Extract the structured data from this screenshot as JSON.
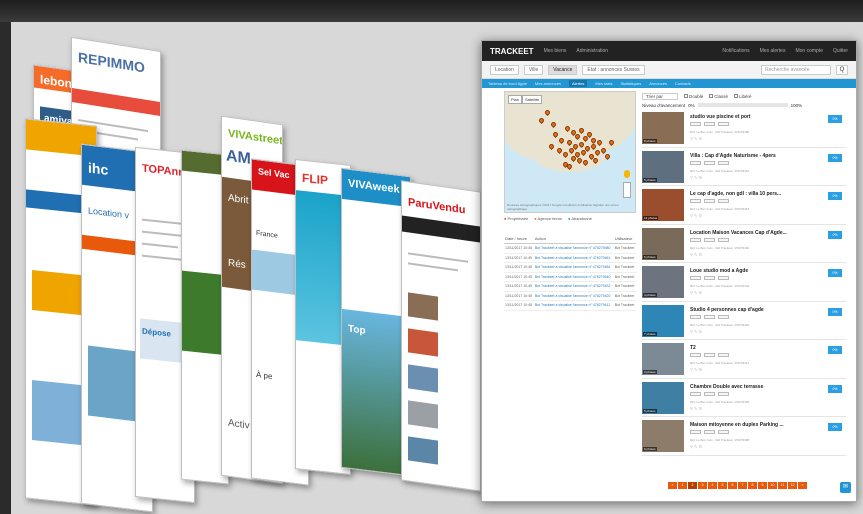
{
  "collage": {
    "sites": [
      {
        "brand": "",
        "color": "#f0a400"
      },
      {
        "brand": "leboncoin",
        "color": "#f56b2a"
      },
      {
        "brand": "REPIMMO",
        "color": "#4a6fa5"
      },
      {
        "brand": "ihc",
        "color": "#1f6fb2"
      },
      {
        "brand": "TOPAnnonces",
        "color": "#e0242d"
      },
      {
        "brand": "",
        "color": "#556b2f"
      },
      {
        "brand": "VIVAstreet",
        "color": "#7ab51d"
      },
      {
        "brand": "AM",
        "color": "#3a5f9a"
      },
      {
        "brand": "FLIP",
        "color": "#e6302b"
      },
      {
        "brand": "VIVAweek",
        "color": "#1e8fc6"
      },
      {
        "brand": "ParuVendu",
        "color": "#d7141a"
      }
    ],
    "extra_text": {
      "amivac": "amivac",
      "location": "Location v",
      "topannonces_short": "TOPAnno",
      "abrit": "Abrit",
      "res": "Rés",
      "activ": "Activ",
      "top": "Top",
      "france": "France",
      "sel_vac": "Sel Vac",
      "dop": "Dépose",
      "a_pe": "À pe"
    }
  },
  "navbar": {
    "logo": "TRACKEET",
    "links": [
      "Mes biens",
      "Administration"
    ],
    "right": [
      "Notifications",
      "Mes alertes",
      "Mon compte",
      "Quitter"
    ]
  },
  "search": {
    "selects": [
      "Location",
      "Ville",
      "Vacance",
      "Etat : annonces Suivies"
    ],
    "placeholder": "Recherche avancée",
    "button": "Q"
  },
  "tabs": [
    "Tableau de bord Agde",
    "Mes annonces",
    "Alertes",
    "Mes stats",
    "Statistiques",
    "Annonces",
    "Contacts"
  ],
  "active_tab_index": 2,
  "map": {
    "controls": [
      "Plan",
      "Satellite"
    ],
    "footer": "Données cartographiques ©2017 Google   Conditions d'utilisation   Signaler une erreur cartographique",
    "legend": [
      "Propriétaire",
      "Agence immo",
      "Abandonné"
    ]
  },
  "log": {
    "headers": [
      "Date / heure",
      "Action",
      "Utilisateur"
    ],
    "rows": [
      {
        "date": "13/11/2017 10:45",
        "action": "Bot Trackeet a visualisé l'annonce n° 476279480",
        "user": "Bot Trackeet"
      },
      {
        "date": "13/11/2017 10:45",
        "action": "Bot Trackeet a visualisé l'annonce n° 476279461",
        "user": "Bot Trackeet"
      },
      {
        "date": "13/11/2017 10:45",
        "action": "Bot Trackeet a visualisé l'annonce n° 476279454",
        "user": "Bot Trackeet"
      },
      {
        "date": "13/11/2017 10:45",
        "action": "Bot Trackeet a visualisé l'annonce n° 476279440",
        "user": "Bot Trackeet"
      },
      {
        "date": "13/11/2017 10:45",
        "action": "Bot Trackeet a visualisé l'annonce n° 476279432",
        "user": "Bot Trackeet"
      },
      {
        "date": "13/11/2017 10:45",
        "action": "Bot Trackeet a visualisé l'annonce n° 476279420",
        "user": "Bot Trackeet"
      },
      {
        "date": "13/11/2017 10:45",
        "action": "Bot Trackeet a visualisé l'annonce n° 476279411",
        "user": "Bot Trackeet"
      }
    ]
  },
  "filters": {
    "sort": "Trier par",
    "options": [
      "Doublé",
      "Classé",
      "Libéré"
    ]
  },
  "progress": {
    "label": "Niveau d'avancement",
    "value_pct": 0,
    "value_text": "0%",
    "max_text": "100%"
  },
  "listings": [
    {
      "title": "studio vue piscine et port",
      "meta": "Réf: Le Bon Coin · Réf Trackeet: 476279480",
      "photos": "8 photos",
      "pct": "0%",
      "img": "#8a6d55"
    },
    {
      "title": "Villa : Cap d'Agde Naturisme - 4pers",
      "meta": "Réf: Le Bon Coin · Réf Trackeet: 476279461",
      "photos": "5 photos",
      "pct": "0%",
      "img": "#5e6f80"
    },
    {
      "title": "Le cap d'agde, non gdl : villa 10 pers...",
      "meta": "Réf: Le Bon Coin · Réf Trackeet: 476279454",
      "photos": "12 photos",
      "pct": "0%",
      "img": "#9a4e2d"
    },
    {
      "title": "Location Maison Vacances Cap d'Agde...",
      "meta": "Réf: Le Bon Coin · Réf Trackeet: 476279440",
      "photos": "6 photos",
      "pct": "0%",
      "img": "#7a6a5a"
    },
    {
      "title": "Loue studio mod a Agde",
      "meta": "Réf: Le Bon Coin · Réf Trackeet: 476279432",
      "photos": "4 photos",
      "pct": "0%",
      "img": "#6d7480"
    },
    {
      "title": "Studio 4 personnes cap d'agde",
      "meta": "Réf: Le Bon Coin · Réf Trackeet: 476279420",
      "photos": "7 photos",
      "pct": "0%",
      "img": "#2d86b5"
    },
    {
      "title": "T2",
      "meta": "Réf: Le Bon Coin · Réf Trackeet: 476279411",
      "photos": "3 photos",
      "pct": "0%",
      "img": "#7b8a95"
    },
    {
      "title": "Chambre Double avec terrasse",
      "meta": "Réf: Le Bon Coin · Réf Trackeet: 476279402",
      "photos": "5 photos",
      "pct": "0%",
      "img": "#3e7fa3"
    },
    {
      "title": "Maison mitoyenne en duplex Parking ...",
      "meta": "Réf: Le Bon Coin · Réf Trackeet: 476279398",
      "photos": "9 photos",
      "pct": "0%",
      "img": "#8e7c6a"
    }
  ],
  "pager": [
    "«",
    "1",
    "2",
    "3",
    "4",
    "5",
    "6",
    "7",
    "8",
    "9",
    "10",
    "11",
    "12",
    "»"
  ],
  "pager_current": "2",
  "chat_icon": "chat-icon"
}
